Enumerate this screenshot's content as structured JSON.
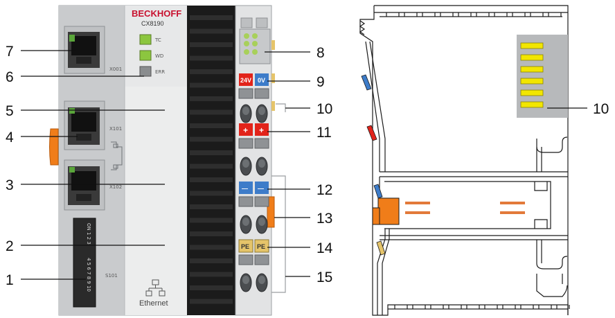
{
  "brand": "BECKHOFF",
  "model": "CX8190",
  "leds": {
    "tc": "TC",
    "wd": "WD",
    "err": "ERR"
  },
  "ports": {
    "x001": "X001",
    "x101": "X101",
    "x102": "X102",
    "s101": "S101"
  },
  "dip_top_labels": "ON 1 2 3",
  "dip_bottom_labels": "4 5 6 7 8 9 10",
  "terminal_labels": {
    "v24": "24V",
    "v0": "0V",
    "plus": "+",
    "minus": "—",
    "pe": "PE"
  },
  "ethernet_label": "Ethernet",
  "callouts_left": [
    "1",
    "2",
    "3",
    "4",
    "5",
    "6",
    "7"
  ],
  "callouts_right": [
    "8",
    "9",
    "10",
    "11",
    "12",
    "13",
    "14",
    "15"
  ],
  "callout_side_view": "10",
  "colors": {
    "housing": "#d4d6d8",
    "housing_light": "#e6e7e8",
    "housing_dark": "#c3c5c7",
    "fins": "#1b1b1b",
    "led_green": "#8cc63f",
    "terminal_red": "#e2231a",
    "terminal_blue": "#3d7cc9",
    "pe_yellow": "#e5c46a",
    "release_orange": "#f07d19",
    "contact_yellow": "#f2e600"
  }
}
